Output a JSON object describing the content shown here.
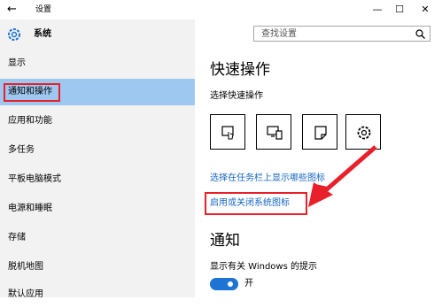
{
  "window": {
    "title": "设置"
  },
  "header": {
    "section": "系统",
    "search_placeholder": "查找设置"
  },
  "sidebar": {
    "items": [
      {
        "label": "显示"
      },
      {
        "label": "通知和操作"
      },
      {
        "label": "应用和功能"
      },
      {
        "label": "多任务"
      },
      {
        "label": "平板电脑模式"
      },
      {
        "label": "电源和睡眠"
      },
      {
        "label": "存储"
      },
      {
        "label": "脱机地图"
      },
      {
        "label": "默认应用"
      }
    ],
    "selected": "通知和操作"
  },
  "main": {
    "title": "快速操作",
    "subtitle": "选择快速操作",
    "quick_actions": [
      {
        "icon": "tablet-touch-icon"
      },
      {
        "icon": "project-display-icon"
      },
      {
        "icon": "note-icon"
      },
      {
        "icon": "settings-gear-icon"
      }
    ],
    "link_taskbar_icons": "选择在任务栏上显示哪些图标",
    "link_system_icons": "启用或关闭系统图标",
    "notify_title": "通知",
    "notify_tips_label": "显示有关 Windows 的提示",
    "notify_tips_state": "开"
  },
  "colors": {
    "accent": "#1d74d2",
    "highlight": "#e8202a",
    "selected_bg": "#9ec8ef"
  }
}
